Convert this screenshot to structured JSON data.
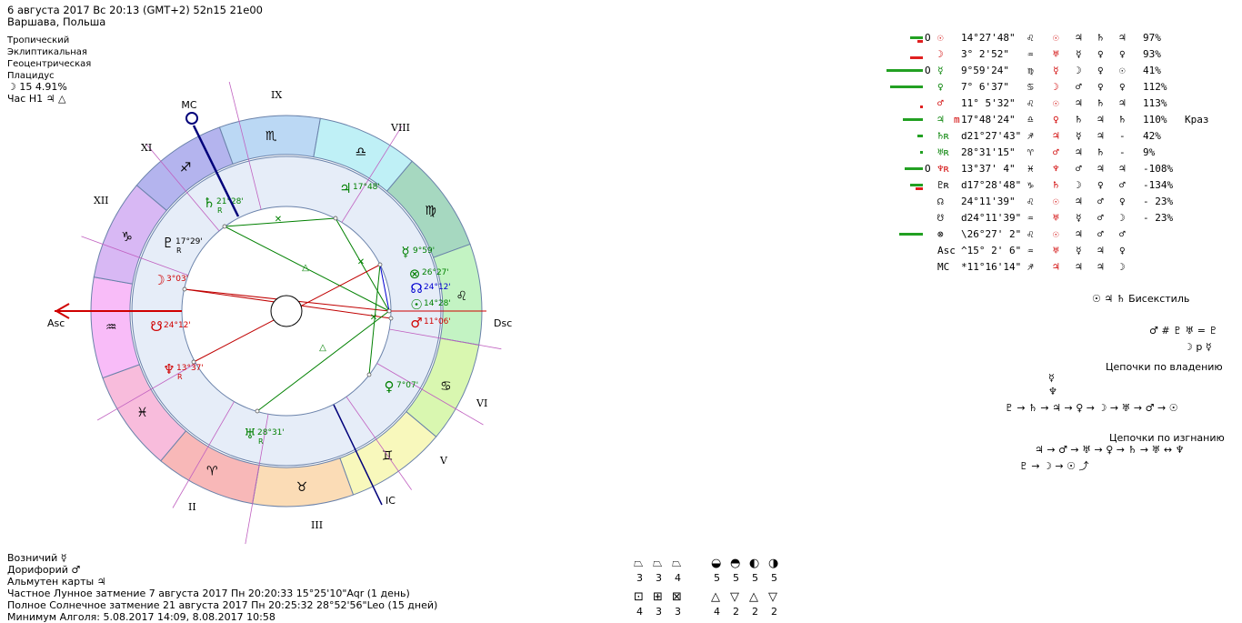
{
  "header": {
    "line1": "6 августа 2017  Вс  20:13 (GMT+2) 52n15  21e00",
    "line2": "Варшава, Польша"
  },
  "settings": {
    "items": [
      "Тропический",
      "Эклиптикальная",
      "Геоцентрическая",
      "Плацидус"
    ],
    "moon_phase": "☽  15 4.91%",
    "hour": "Час Н1  ♃ △"
  },
  "chart": {
    "angle_labels": {
      "mc": "MC",
      "asc": "Asc",
      "dsc": "Dsc",
      "ic": "IC"
    },
    "house_labels": [
      "IX",
      "VIII",
      "XI",
      "XII",
      "VI",
      "V",
      "II",
      "III"
    ],
    "signs": [
      {
        "glyph": "♐",
        "name": "sagittarius",
        "color": "#b4b4ee"
      },
      {
        "glyph": "♏",
        "name": "scorpio",
        "color": "#bbd8f4"
      },
      {
        "glyph": "♎",
        "name": "libra",
        "color": "#bff0f6"
      },
      {
        "glyph": "♍",
        "name": "virgo",
        "color": "#a6d8c0"
      },
      {
        "glyph": "♌",
        "name": "leo",
        "color": "#c3f3c3"
      },
      {
        "glyph": "♋",
        "name": "cancer",
        "color": "#d9f7b0"
      },
      {
        "glyph": "♊",
        "name": "gemini",
        "color": "#f8f8bc"
      },
      {
        "glyph": "♉",
        "name": "taurus",
        "color": "#fbdcb6"
      },
      {
        "glyph": "♈",
        "name": "aries",
        "color": "#f8b8b8"
      },
      {
        "glyph": "♓",
        "name": "pisces",
        "color": "#f8bcdc"
      },
      {
        "glyph": "♒",
        "name": "aquarius",
        "color": "#f8bcf8"
      },
      {
        "glyph": "♑",
        "name": "capricorn",
        "color": "#d8b8f4"
      }
    ],
    "planets": [
      {
        "glyph": "♄",
        "deg": "21°28'",
        "retro": "R",
        "color": "#008000"
      },
      {
        "glyph": "♃",
        "deg": "17°48'",
        "retro": "",
        "color": "#008000"
      },
      {
        "glyph": "♇",
        "deg": "17°29'",
        "retro": "R",
        "color": "#000000"
      },
      {
        "glyph": "☿",
        "deg": "9°59'",
        "retro": "",
        "color": "#008000"
      },
      {
        "glyph": "⊗",
        "deg": "26°27'",
        "retro": "",
        "color": "#008000"
      },
      {
        "glyph": "☊",
        "deg": "24°12'",
        "retro": "",
        "color": "#0000d0"
      },
      {
        "glyph": "☉",
        "deg": "14°28'",
        "retro": "",
        "color": "#008000"
      },
      {
        "glyph": "♂",
        "deg": "11°06'",
        "retro": "",
        "color": "#d00000"
      },
      {
        "glyph": "☽",
        "deg": "3°03'",
        "retro": "",
        "color": "#d00000"
      },
      {
        "glyph": "☋",
        "deg": "24°12'",
        "retro": "",
        "color": "#d00000"
      },
      {
        "glyph": "♆",
        "deg": "13°37'",
        "retro": "R",
        "color": "#d00000"
      },
      {
        "glyph": "♀",
        "deg": "7°07'",
        "retro": "",
        "color": "#008000"
      },
      {
        "glyph": "♅",
        "deg": "28°31'",
        "retro": "R",
        "color": "#008000"
      }
    ],
    "aspect_symbols": [
      "✕",
      "△",
      "✕",
      "△",
      "✕"
    ]
  },
  "planet_table": [
    {
      "mark": "O",
      "glyph": "☉",
      "retro": "",
      "flag": "",
      "pos": "14°27'48\"",
      "sign": "♌",
      "r1": "☉",
      "r2": "♃",
      "r3": "♄",
      "r4": "♃",
      "pct": "97%",
      "note": "",
      "bar_green": 14,
      "bar_red": 6,
      "color": "#d00000"
    },
    {
      "mark": "",
      "glyph": "☽",
      "retro": "",
      "flag": "",
      "pos": "3° 2'52\"",
      "sign": "♒",
      "r1": "♅",
      "r2": "☿",
      "r3": "♀",
      "r4": "♀",
      "pct": "93%",
      "note": "",
      "bar_green": 0,
      "bar_red": 14,
      "color": "#d00000"
    },
    {
      "mark": "O",
      "glyph": "☿",
      "retro": "",
      "flag": "",
      "pos": "9°59'24\"",
      "sign": "♍",
      "r1": "☿",
      "r2": "☽",
      "r3": "♀",
      "r4": "☉",
      "pct": "41%",
      "note": "",
      "bar_green": 40,
      "bar_red": 0,
      "color": "#008000"
    },
    {
      "mark": "",
      "glyph": "♀",
      "retro": "",
      "flag": "",
      "pos": "7° 6'37\"",
      "sign": "♋",
      "r1": "☽",
      "r2": "♂",
      "r3": "♀",
      "r4": "♀",
      "pct": "112%",
      "note": "",
      "bar_green": 36,
      "bar_red": 0,
      "color": "#008000"
    },
    {
      "mark": "",
      "glyph": "♂",
      "retro": "",
      "flag": "",
      "pos": "11° 5'32\"",
      "sign": "♌",
      "r1": "☉",
      "r2": "♃",
      "r3": "♄",
      "r4": "♃",
      "pct": "113%",
      "note": "",
      "bar_green": 0,
      "bar_red": 3,
      "color": "#d00000"
    },
    {
      "mark": "",
      "glyph": "♃",
      "retro": "",
      "flag": "m",
      "pos": "17°48'24\"",
      "sign": "♎",
      "r1": "♀",
      "r2": "♄",
      "r3": "♃",
      "r4": "♄",
      "pct": "110%",
      "note": "Краз",
      "bar_green": 22,
      "bar_red": 0,
      "color": "#008000"
    },
    {
      "mark": "",
      "glyph": "♄",
      "retro": "R",
      "flag": "",
      "pos": "d21°27'43\"",
      "sign": "♐",
      "r1": "♃",
      "r2": "☿",
      "r3": "♃",
      "r4": "-",
      "pct": "42%",
      "note": "",
      "bar_green": 6,
      "bar_red": 0,
      "color": "#008000"
    },
    {
      "mark": "",
      "glyph": "♅",
      "retro": "R",
      "flag": "",
      "pos": "28°31'15\"",
      "sign": "♈",
      "r1": "♂",
      "r2": "♃",
      "r3": "♄",
      "r4": "-",
      "pct": "9%",
      "note": "",
      "bar_green": 3,
      "bar_red": 0,
      "color": "#008000"
    },
    {
      "mark": "O",
      "glyph": "♆",
      "retro": "R",
      "flag": "",
      "pos": "13°37' 4\"",
      "sign": "♓",
      "r1": "♆",
      "r2": "♂",
      "r3": "♃",
      "r4": "♃",
      "pct": "-108%",
      "note": "",
      "bar_green": 20,
      "bar_red": 0,
      "color": "#d00000"
    },
    {
      "mark": "",
      "glyph": "♇",
      "retro": "R",
      "flag": "",
      "pos": "d17°28'48\"",
      "sign": "♑",
      "r1": "♄",
      "r2": "☽",
      "r3": "♀",
      "r4": "♂",
      "pct": "-134%",
      "note": "",
      "bar_green": 14,
      "bar_red": 8,
      "color": "#000000"
    },
    {
      "mark": "",
      "glyph": "☊",
      "retro": "",
      "flag": "",
      "pos": "24°11'39\"",
      "sign": "♌",
      "r1": "☉",
      "r2": "♃",
      "r3": "♂",
      "r4": "♀",
      "pct": "- 23%",
      "note": "",
      "bar_green": 0,
      "bar_red": 0,
      "color": "#000000"
    },
    {
      "mark": "",
      "glyph": "☋",
      "retro": "",
      "flag": "",
      "pos": "d24°11'39\"",
      "sign": "♒",
      "r1": "♅",
      "r2": "☿",
      "r3": "♂",
      "r4": "☽",
      "pct": "- 23%",
      "note": "",
      "bar_green": 0,
      "bar_red": 0,
      "color": "#000000"
    },
    {
      "mark": "",
      "glyph": "⊗",
      "retro": "",
      "flag": "",
      "pos": "\\26°27' 2\"",
      "sign": "♌",
      "r1": "☉",
      "r2": "♃",
      "r3": "♂",
      "r4": "♂",
      "pct": "",
      "note": "",
      "bar_green": 26,
      "bar_red": 0,
      "color": "#000000"
    },
    {
      "mark": "",
      "glyph": "Asc",
      "retro": "",
      "flag": "",
      "pos": "^15° 2' 6\"",
      "sign": "♒",
      "r1": "♅",
      "r2": "☿",
      "r3": "♃",
      "r4": "♀",
      "pct": "",
      "note": "",
      "bar_green": 0,
      "bar_red": 0,
      "color": "#000000"
    },
    {
      "mark": "",
      "glyph": "MC",
      "retro": "",
      "flag": "",
      "pos": "*11°16'14\"",
      "sign": "♐",
      "r1": "♃",
      "r2": "♃",
      "r3": "♃",
      "r4": "☽",
      "pct": "",
      "note": "",
      "bar_green": 0,
      "bar_red": 0,
      "color": "#000000"
    }
  ],
  "right_panel": {
    "bisextile": "☉ ♃ ♄   Бисекстиль",
    "relation1": "♂ # ♇ ♅ = ♇",
    "relation2": "☽ p ☿",
    "chains_ownership_title": "Цепочки по владению",
    "chains_ownership_top1": "☿",
    "chains_ownership_top2": "♆",
    "chains_ownership_line": "♇ → ♄ → ♃ → ♀ → ☽ → ♅ → ♂ → ☉",
    "chains_exile_title": "Цепочки по изгнанию",
    "chains_exile_line1": "♃ → ♂ → ♅ → ♀ → ♄ → ♅ ↔ ♆",
    "chains_exile_line2": "♇ → ☽ → ☉ ⤴"
  },
  "bottom_info": {
    "lines": [
      "Возничий  ☿",
      "Дорифорий  ♂",
      "Альмутен карты  ♃",
      "Частное Лунное затмение 7 августа 2017 Пн 20:20:33 15°25'10\"Aqr (1 день)",
      "Полное Солнечное затмение 21 августа 2017 Пн 20:25:32 28°52'56\"Leo (15 дней)",
      "Минимум Алголя: 5.08.2017 14:09,  8.08.2017 10:58"
    ]
  },
  "stats": {
    "groups": [
      {
        "symbols": [
          "⏢",
          "⏢",
          "⏢"
        ],
        "counts": [
          "3",
          "3",
          "4"
        ]
      },
      {
        "symbols": [
          "◒",
          "◓",
          "◐",
          "◑"
        ],
        "counts": [
          "5",
          "5",
          "5",
          "5"
        ]
      },
      {
        "symbols": [
          "⊡",
          "⊞",
          "⊠"
        ],
        "counts": [
          "4",
          "3",
          "3"
        ]
      },
      {
        "symbols": [
          "△",
          "▽",
          "△",
          "▽"
        ],
        "counts": [
          "4",
          "2",
          "2",
          "2"
        ]
      }
    ]
  }
}
